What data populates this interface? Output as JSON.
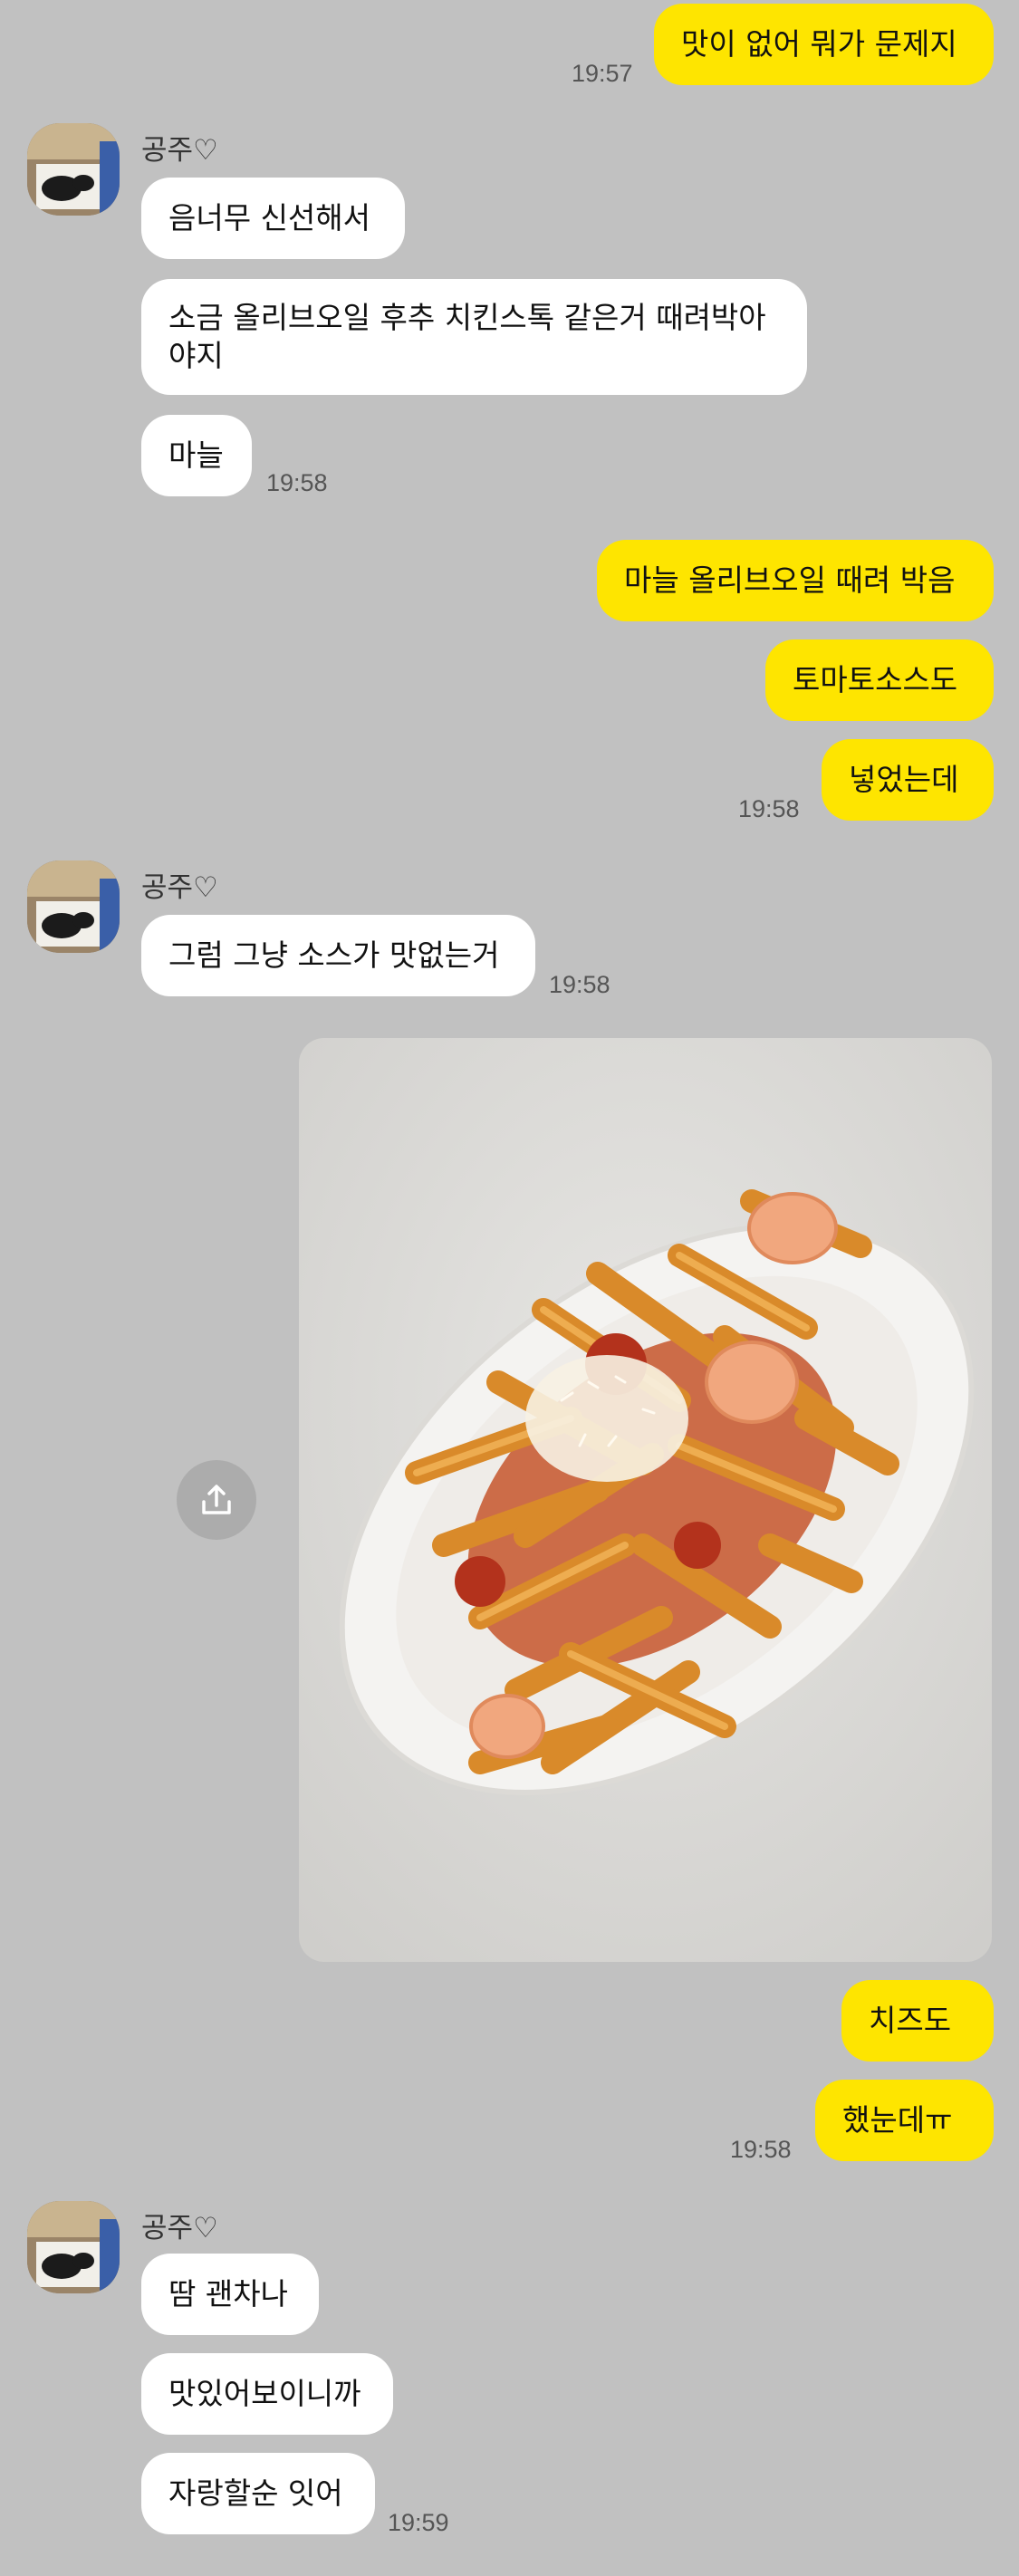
{
  "contact": {
    "name": "공주♡"
  },
  "colors": {
    "background": "#c1c1c1",
    "my_bubble": "#fee500",
    "their_bubble": "#ffffff"
  },
  "messages": [
    {
      "from": "me",
      "text": "맛이 없어 뭐가 문제지",
      "time": "19:57"
    },
    {
      "from": "them",
      "text": "음너무 신선해서"
    },
    {
      "from": "them",
      "text_line1": "소금 올리브오일 후추 치킨스톡 같은거 때려박아",
      "text_line2": "야지"
    },
    {
      "from": "them",
      "text": "마늘",
      "time": "19:58"
    },
    {
      "from": "me",
      "text": "마늘 올리브오일 때려 박음"
    },
    {
      "from": "me",
      "text": "토마토소스도"
    },
    {
      "from": "me",
      "text": "넣었는데",
      "time": "19:58"
    },
    {
      "from": "them",
      "text": "그럼 그냥 소스가 맛없는거",
      "time": "19:58"
    },
    {
      "from": "me",
      "type": "photo",
      "icon": "share-icon"
    },
    {
      "from": "me",
      "text": "치즈도"
    },
    {
      "from": "me",
      "text": "했눈데ㅠ",
      "time": "19:58"
    },
    {
      "from": "them",
      "text": "땀 괜차나"
    },
    {
      "from": "them",
      "text": "맛있어보이니까"
    },
    {
      "from": "them",
      "text": "자랑할순 잇어",
      "time": "19:59"
    }
  ]
}
